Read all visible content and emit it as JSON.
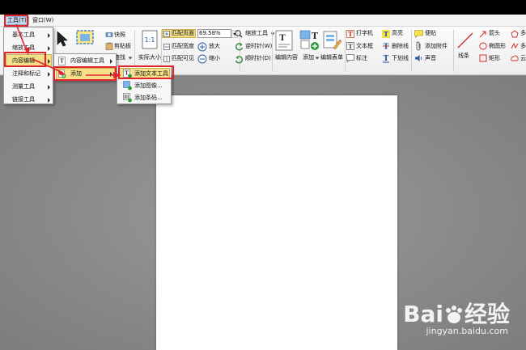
{
  "menubar": {
    "tools": "工具(T)",
    "window": "窗口(W)"
  },
  "ribbon": {
    "snapshot": "快照",
    "clipboard": "剪贴板",
    "find": "查找",
    "actual_size": "实际大小",
    "fit_page": "匹配页面",
    "fit_width": "匹配宽度",
    "fit_visible": "匹配可见",
    "zoom_value": "69.58%",
    "zoom_in": "放大",
    "zoom_out": "缩小",
    "zoom_tool": "缩放工具",
    "rotate_left": "逆时针(W)",
    "rotate_right": "顺时针(D)",
    "edit_content": "编辑内容",
    "add": "添加",
    "edit_form": "编辑表单",
    "typewriter": "打字机",
    "textbox": "文本框",
    "callout": "标注",
    "highlight": "高亮",
    "strikeout": "删除线",
    "underline": "下划线",
    "note": "便贴",
    "attach_file": "添加附件",
    "sound": "声音",
    "line": "线条",
    "arrow": "箭头",
    "ellipse": "椭圆形",
    "rectangle": "矩形",
    "polygon": "多",
    "polyline": "多",
    "cloud": "云"
  },
  "tools_menu": [
    {
      "label": "基本工具"
    },
    {
      "label": "缩放工具"
    },
    {
      "label": "内容编辑"
    },
    {
      "label": "注释和标记"
    },
    {
      "label": "测量工具"
    },
    {
      "label": "链接工具"
    }
  ],
  "content_edit_menu": [
    {
      "label": "内容编辑工具"
    },
    {
      "label": "添加"
    }
  ],
  "add_menu": [
    {
      "label": "添加文本工具"
    },
    {
      "label": "添加图像..."
    },
    {
      "label": "添加条码..."
    }
  ],
  "watermark": {
    "brand_left": "Bai",
    "brand_right": "经验",
    "url": "jingyan.baidu.com"
  },
  "colors": {
    "highlight": "#f6e08a",
    "annotation_red": "#e0242b",
    "title_bar": "#000000"
  }
}
